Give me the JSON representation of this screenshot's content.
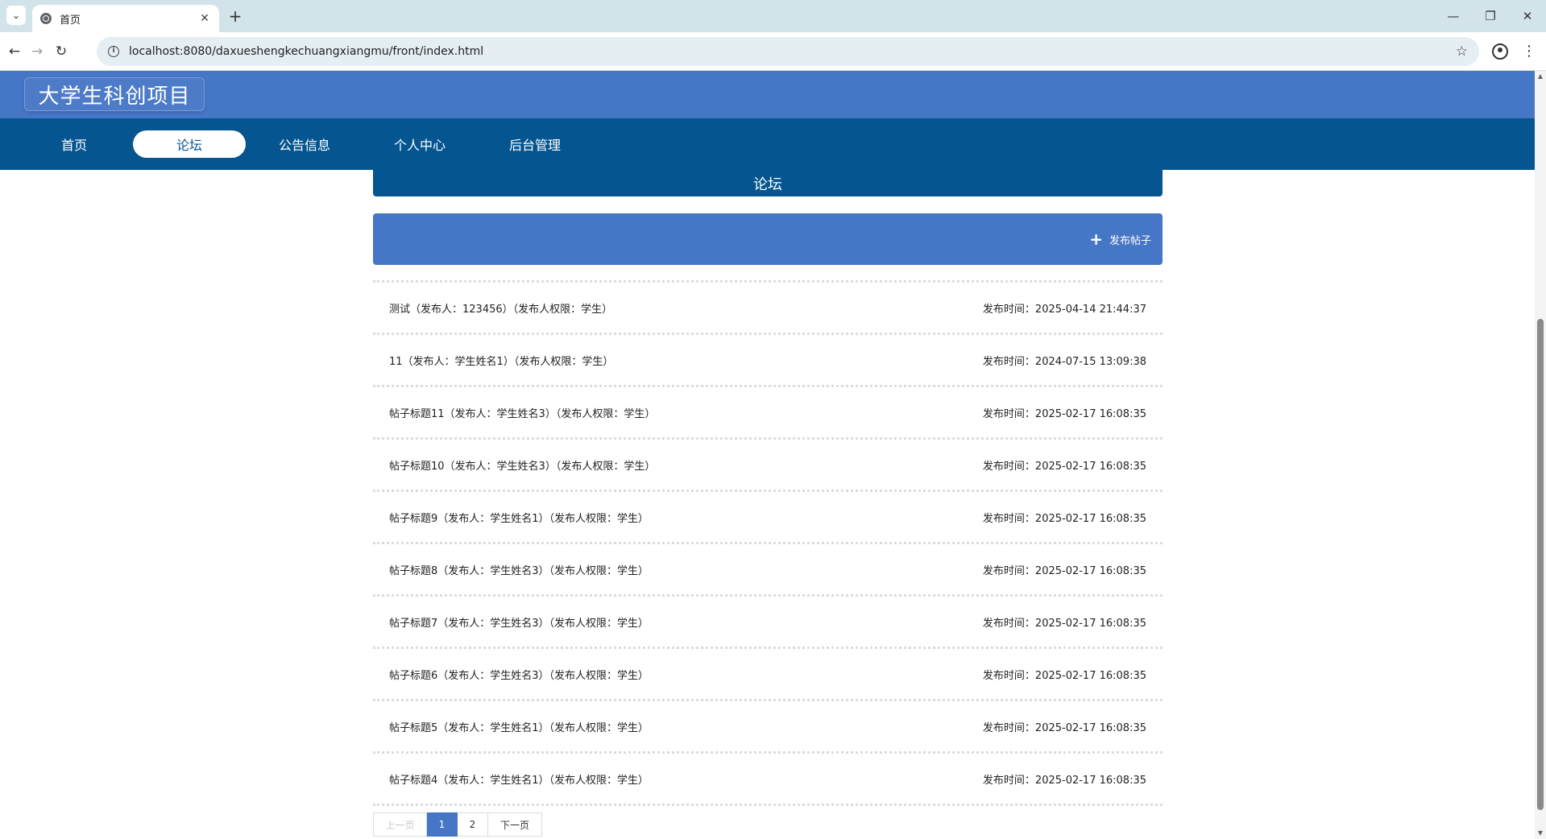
{
  "browser": {
    "tab_title": "首页",
    "new_tab": "+",
    "url": "localhost:8080/daxueshengkechuangxiangmu/front/index.html",
    "controls": {
      "minimize": "—",
      "restore": "❐",
      "close": "✕"
    },
    "tab_close": "✕"
  },
  "site": {
    "title": "大学生科创项目"
  },
  "nav": {
    "items": [
      {
        "label": "首页",
        "active": false
      },
      {
        "label": "论坛",
        "active": true
      },
      {
        "label": "公告信息",
        "active": false
      },
      {
        "label": "个人中心",
        "active": false
      },
      {
        "label": "后台管理",
        "active": false
      }
    ]
  },
  "forum": {
    "banner": "论坛",
    "post_button": "发布帖子",
    "posts": [
      {
        "title": "测试（发布人：123456）（发布人权限：学生）",
        "time": "发布时间：2025-04-14 21:44:37"
      },
      {
        "title": "11（发布人：学生姓名1）（发布人权限：学生）",
        "time": "发布时间：2024-07-15 13:09:38"
      },
      {
        "title": "帖子标题11（发布人：学生姓名3）（发布人权限：学生）",
        "time": "发布时间：2025-02-17 16:08:35"
      },
      {
        "title": "帖子标题10（发布人：学生姓名3）（发布人权限：学生）",
        "time": "发布时间：2025-02-17 16:08:35"
      },
      {
        "title": "帖子标题9（发布人：学生姓名1）（发布人权限：学生）",
        "time": "发布时间：2025-02-17 16:08:35"
      },
      {
        "title": "帖子标题8（发布人：学生姓名3）（发布人权限：学生）",
        "time": "发布时间：2025-02-17 16:08:35"
      },
      {
        "title": "帖子标题7（发布人：学生姓名3）（发布人权限：学生）",
        "time": "发布时间：2025-02-17 16:08:35"
      },
      {
        "title": "帖子标题6（发布人：学生姓名3）（发布人权限：学生）",
        "time": "发布时间：2025-02-17 16:08:35"
      },
      {
        "title": "帖子标题5（发布人：学生姓名1）（发布人权限：学生）",
        "time": "发布时间：2025-02-17 16:08:35"
      },
      {
        "title": "帖子标题4（发布人：学生姓名1）（发布人权限：学生）",
        "time": "发布时间：2025-02-17 16:08:35"
      }
    ]
  },
  "pagination": {
    "prev": "上一页",
    "pages": [
      "1",
      "2"
    ],
    "current": "1",
    "next": "下一页"
  }
}
